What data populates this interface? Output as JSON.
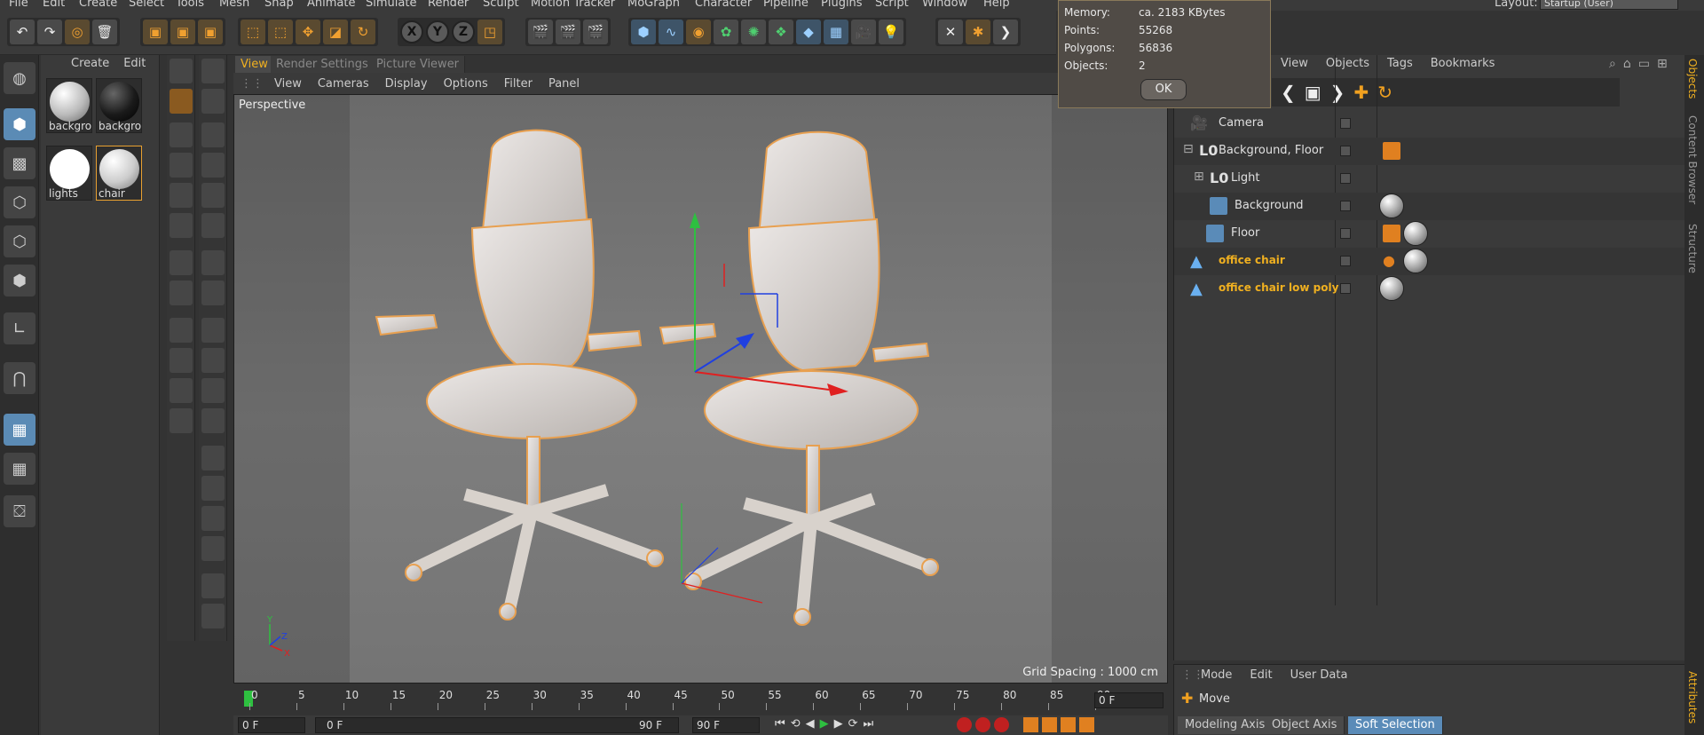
{
  "menubar": {
    "items": [
      "File",
      "Edit",
      "Create",
      "Select",
      "Tools",
      "Mesh",
      "Snap",
      "Animate",
      "Simulate",
      "Render",
      "Sculpt",
      "Motion Tracker",
      "MoGraph",
      "Character",
      "Pipeline",
      "Plugins",
      "Script",
      "Window",
      "Help"
    ],
    "layout_label": "Layout:",
    "layout_value": "Startup (User)"
  },
  "toolbar": {
    "axis_x": "X",
    "axis_y": "Y",
    "axis_z": "Z"
  },
  "materials": {
    "menu": [
      "Create",
      "Edit"
    ],
    "items": [
      {
        "label": "backgro",
        "color": "#c8c8c8"
      },
      {
        "label": "backgro",
        "color": "#262626"
      },
      {
        "label": "lights",
        "color": "#ffffff"
      },
      {
        "label": "chair",
        "color": "#d8d8d8"
      }
    ]
  },
  "viewport": {
    "tabs": [
      "View",
      "Render Settings",
      "Picture Viewer"
    ],
    "menu": [
      "View",
      "Cameras",
      "Display",
      "Options",
      "Filter",
      "Panel"
    ],
    "label": "Perspective",
    "grid_spacing": "Grid Spacing : 1000 cm",
    "axis_labels": {
      "y": "Y",
      "z": "Z",
      "x": "X"
    }
  },
  "timeline": {
    "ticks": [
      "0",
      "5",
      "10",
      "15",
      "20",
      "25",
      "30",
      "35",
      "40",
      "45",
      "50",
      "55",
      "60",
      "65",
      "70",
      "75",
      "80",
      "85",
      "90"
    ],
    "current_frame": "0 F",
    "start_field": "0 F",
    "range_start": "0 F",
    "range_end": "90 F",
    "end_field": "90 F"
  },
  "object_manager": {
    "menu": [
      "View",
      "Objects",
      "Tags",
      "Bookmarks"
    ],
    "objects": [
      {
        "name": "Camera",
        "indent": 0,
        "highlight": false
      },
      {
        "name": "Background, Floor",
        "indent": 0,
        "highlight": false
      },
      {
        "name": "Light",
        "indent": 1,
        "highlight": false
      },
      {
        "name": "Background",
        "indent": 2,
        "highlight": false
      },
      {
        "name": "Floor",
        "indent": 1,
        "highlight": false
      },
      {
        "name": "office chair",
        "indent": 0,
        "highlight": true
      },
      {
        "name": "office chair low poly",
        "indent": 0,
        "highlight": true
      }
    ]
  },
  "attributes": {
    "menu": [
      "Mode",
      "Edit",
      "User Data"
    ],
    "tool": "Move",
    "tabs": [
      "Modeling Axis",
      "Object Axis",
      "Soft Selection"
    ]
  },
  "right_tabs": [
    "Objects",
    "Content Browser",
    "Structure",
    "Attributes"
  ],
  "popup": {
    "rows": [
      {
        "label": "Memory:",
        "value": "ca. 2183 KBytes"
      },
      {
        "label": "Points:",
        "value": "55268"
      },
      {
        "label": "Polygons:",
        "value": "56836"
      },
      {
        "label": "Objects:",
        "value": "2"
      }
    ],
    "ok_label": "OK"
  },
  "colors": {
    "accent": "#f0b020",
    "selection": "#5a8bb8",
    "chair_outline": "#e8a050"
  }
}
